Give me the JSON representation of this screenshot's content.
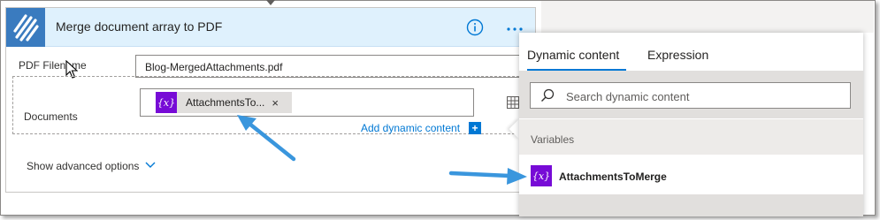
{
  "card": {
    "title": "Merge document array to PDF",
    "icon": "flow-icon",
    "info_icon": "info-icon",
    "more_icon": "more-options-icon"
  },
  "fields": {
    "pdf_filename_label": "PDF Filename",
    "pdf_filename_value": "Blog-MergedAttachments.pdf",
    "documents_label": "Documents",
    "documents_token": "AttachmentsTo...",
    "token_remove": "×",
    "token_badge": "{x}"
  },
  "add_dynamic_content": "Add dynamic content",
  "add_dynamic_plus": "+",
  "show_advanced": "Show advanced options",
  "panel": {
    "tabs": [
      "Dynamic content",
      "Expression"
    ],
    "active_tab": "Dynamic content",
    "search_placeholder": "Search dynamic content",
    "section": "Variables",
    "items": [
      {
        "badge": "{x}",
        "label": "AttachmentsToMerge"
      }
    ]
  },
  "colors": {
    "accent": "#0078d4",
    "variable_badge": "#770bd6",
    "header_bg": "#dff1fd",
    "annotation_arrow": "#3a96dd"
  }
}
